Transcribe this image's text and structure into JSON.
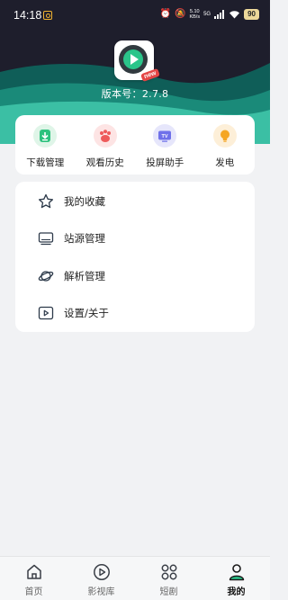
{
  "status_bar": {
    "time": "14:18",
    "net_speed_value": "5.10",
    "net_speed_unit": "KB/s",
    "network": "5G",
    "battery": "90"
  },
  "header": {
    "logo_badge": "new",
    "version_label": "版本号：",
    "version_value": "2.7.8"
  },
  "quick_actions": [
    {
      "label": "下载管理",
      "icon": "download-icon",
      "bg": "#dff5e8",
      "color": "#2ec27e"
    },
    {
      "label": "观看历史",
      "icon": "paw-icon",
      "bg": "#fde4e4",
      "color": "#ee5a5a"
    },
    {
      "label": "投屏助手",
      "icon": "tv-icon",
      "bg": "#e6e6fb",
      "color": "#6f71ea"
    },
    {
      "label": "发电",
      "icon": "lightbulb-icon",
      "bg": "#fdefd8",
      "color": "#f5a623"
    }
  ],
  "menu": [
    {
      "label": "我的收藏",
      "icon": "star-icon"
    },
    {
      "label": "站源管理",
      "icon": "monitor-icon"
    },
    {
      "label": "解析管理",
      "icon": "planet-icon"
    },
    {
      "label": "设置/关于",
      "icon": "play-box-icon"
    }
  ],
  "bottom_nav": [
    {
      "label": "首页",
      "icon": "home-icon"
    },
    {
      "label": "影视库",
      "icon": "play-circle-icon"
    },
    {
      "label": "短剧",
      "icon": "grid-icon"
    },
    {
      "label": "我的",
      "icon": "user-icon",
      "active": true
    }
  ],
  "colors": {
    "accent": "#2bc58a",
    "header_bg": "#1e1e2c",
    "wave_dark": "#0f5e58",
    "wave_mid": "#1a8a79",
    "wave_light": "#3bbfa4"
  }
}
